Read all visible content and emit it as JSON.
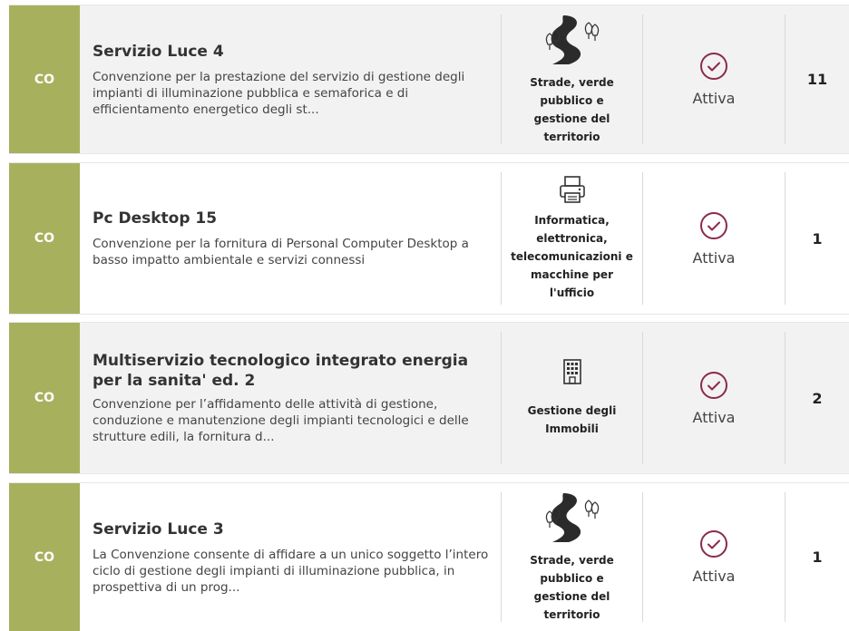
{
  "colors": {
    "badge": "#a7b05d",
    "status_icon": "#8b2a4e"
  },
  "rows": [
    {
      "badge": "CO",
      "title": "Servizio Luce 4",
      "description": "Convenzione per la prestazione del servizio di gestione degli impianti di illuminazione pubblica e semaforica e di efficientamento energetico degli st...",
      "category_icon": "road-trees-icon",
      "category": "Strade, verde pubblico e gestione del territorio",
      "status_icon": "check-circle-icon",
      "status": "Attiva",
      "count": "11"
    },
    {
      "badge": "CO",
      "title": "Pc Desktop 15",
      "description": "Convenzione per la fornitura di Personal Computer Desktop a basso impatto ambientale e servizi connessi",
      "category_icon": "printer-icon",
      "category": "Informatica, elettronica, telecomunicazioni e macchine per l'ufficio",
      "status_icon": "check-circle-icon",
      "status": "Attiva",
      "count": "1"
    },
    {
      "badge": "CO",
      "title": "Multiservizio tecnologico integrato energia per la sanita' ed. 2",
      "description": "Convenzione per l’affidamento delle attività di gestione, conduzione e manutenzione degli impianti tecnologici e delle strutture edili, la fornitura d...",
      "category_icon": "building-icon",
      "category": "Gestione degli Immobili",
      "status_icon": "check-circle-icon",
      "status": "Attiva",
      "count": "2"
    },
    {
      "badge": "CO",
      "title": "Servizio Luce 3",
      "description": "La Convenzione consente di affidare a un unico soggetto l’intero ciclo di gestione degli impianti di illuminazione pubblica, in prospettiva di un prog...",
      "category_icon": "road-trees-icon",
      "category": "Strade, verde pubblico e gestione del territorio",
      "status_icon": "check-circle-icon",
      "status": "Attiva",
      "count": "1"
    }
  ]
}
